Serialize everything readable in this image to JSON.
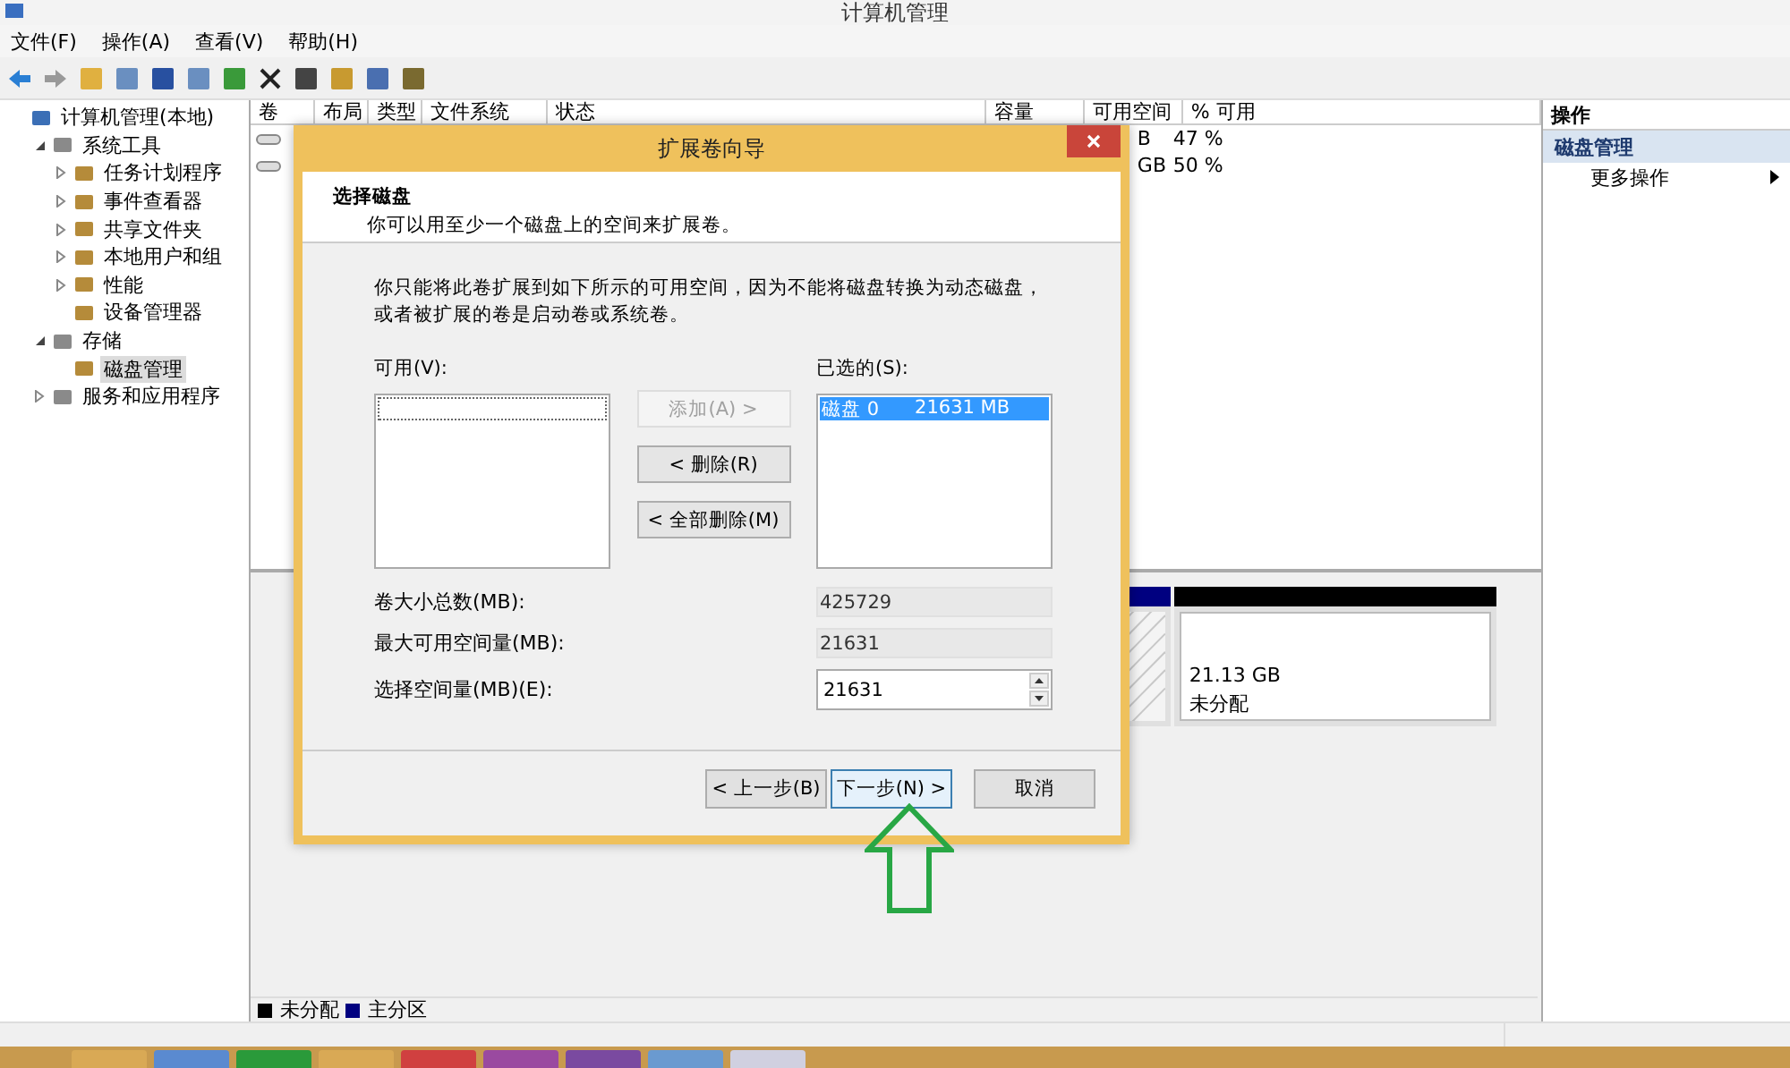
{
  "window": {
    "title": "计算机管理"
  },
  "menu": [
    "文件(F)",
    "操作(A)",
    "查看(V)",
    "帮助(H)"
  ],
  "tree": [
    {
      "label": "计算机管理(本地)",
      "children": [
        {
          "label": "系统工具",
          "expanded": true,
          "children": [
            {
              "label": "任务计划程序",
              "expanded": false
            },
            {
              "label": "事件查看器",
              "expanded": false
            },
            {
              "label": "共享文件夹",
              "expanded": false
            },
            {
              "label": "本地用户和组",
              "expanded": false
            },
            {
              "label": "性能",
              "expanded": false
            },
            {
              "label": "设备管理器"
            }
          ]
        },
        {
          "label": "存储",
          "expanded": true,
          "children": [
            {
              "label": "磁盘管理",
              "selected": true
            }
          ]
        },
        {
          "label": "服务和应用程序",
          "expanded": false
        }
      ]
    }
  ],
  "volumes": {
    "columns": [
      "卷",
      "布局",
      "类型",
      "文件系统",
      "状态",
      "容量",
      "可用空间",
      "% 可用"
    ],
    "rows": [
      {
        "free": "B",
        "pct": "47 %"
      },
      {
        "free": "GB",
        "pct": "50 %"
      }
    ]
  },
  "disk_map": {
    "partitions": [
      {
        "kind": "primary",
        "color": "#000080"
      },
      {
        "kind": "unallocated",
        "color": "#000000",
        "size": "21.13 GB",
        "status": "未分配"
      }
    ],
    "legend": [
      {
        "label": "未分配",
        "color": "#000000"
      },
      {
        "label": "主分区",
        "color": "#000080"
      }
    ]
  },
  "actions": {
    "title": "操作",
    "section": "磁盘管理",
    "items": [
      "更多操作"
    ]
  },
  "dialog": {
    "title": "扩展卷向导",
    "heading": "选择磁盘",
    "subheading": "你可以用至少一个磁盘上的空间来扩展卷。",
    "description": "你只能将此卷扩展到如下所示的可用空间，因为不能将磁盘转换为动态磁盘，或者被扩展的卷是启动卷或系统卷。",
    "available_label": "可用(V):",
    "selected_label": "已选的(S):",
    "selected_items": [
      {
        "disk": "磁盘 0",
        "size": "21631 MB",
        "selected": true
      }
    ],
    "move_buttons": [
      {
        "label": "添加(A) >",
        "disabled": true
      },
      {
        "label": "< 删除(R)",
        "disabled": false
      },
      {
        "label": "< 全部删除(M)",
        "disabled": false
      }
    ],
    "fields": [
      {
        "label": "卷大小总数(MB):",
        "value": "425729",
        "kind": "readonly"
      },
      {
        "label": "最大可用空间量(MB):",
        "value": "21631",
        "kind": "readonly"
      },
      {
        "label": "选择空间量(MB)(E):",
        "value": "21631",
        "kind": "spinner"
      }
    ],
    "buttons": [
      {
        "label": "< 上一步(B)",
        "focused": false
      },
      {
        "label": "下一步(N) >",
        "focused": true
      },
      {
        "label": "取消",
        "focused": false
      }
    ]
  }
}
